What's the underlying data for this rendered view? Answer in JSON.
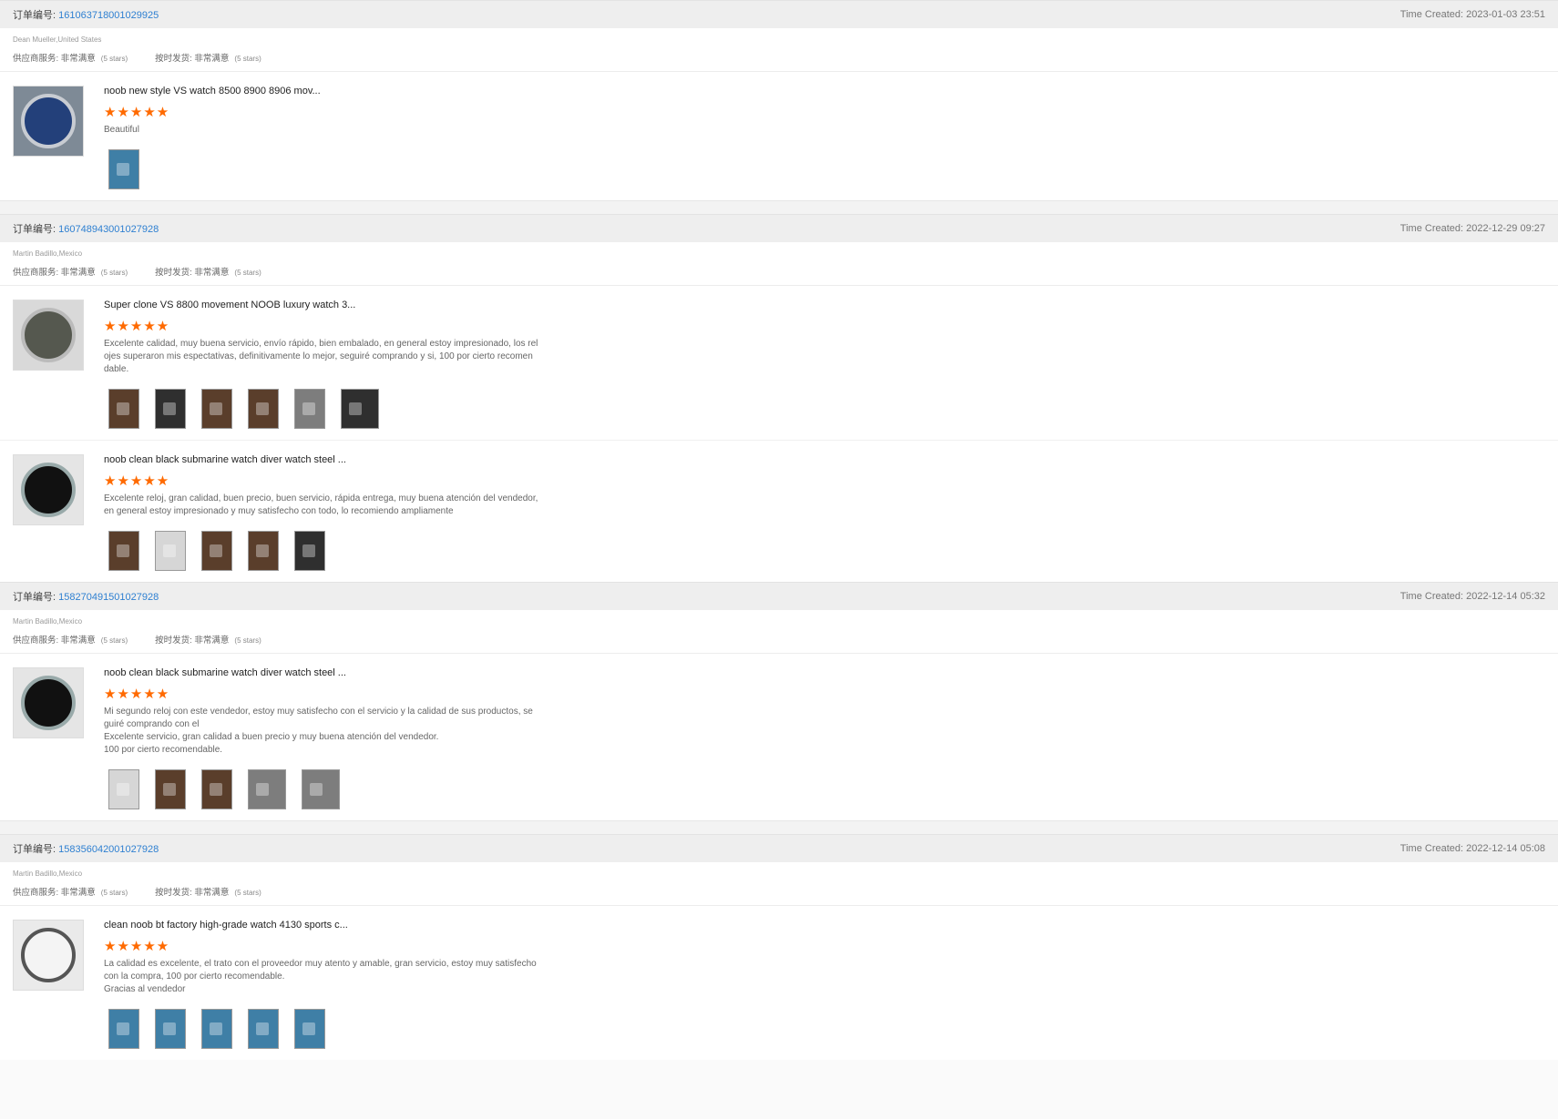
{
  "orders": [
    {
      "order_label": "订单编号:",
      "order_no": "161063718001029925",
      "time_created": "Time Created: 2023-01-03 23:51",
      "buyer": "Dean Mueller,United States",
      "supplier_service": "供应商服务: 非常满意",
      "supplier_stars": "(5 stars)",
      "ship_on_time": "按时发货: 非常满意",
      "ship_stars": "(5 stars)",
      "reviews": [
        {
          "title": "noob new style VS watch 8500 8900 8906 mov...",
          "stars": "★★★★★",
          "comment": "Beautiful"
        }
      ]
    },
    {
      "order_label": "订单编号:",
      "order_no": "160748943001027928",
      "time_created": "Time Created: 2022-12-29 09:27",
      "buyer": "Martin Badillo,Mexico",
      "supplier_service": "供应商服务: 非常满意",
      "supplier_stars": "(5 stars)",
      "ship_on_time": "按时发货: 非常满意",
      "ship_stars": "(5 stars)",
      "reviews": [
        {
          "title": "Super clone VS 8800 movement NOOB luxury watch 3...",
          "stars": "★★★★★",
          "comment": "Excelente calidad, muy buena servicio, envío rápido, bien embalado, en general estoy impresionado, los rel\nojes superaron mis espectativas, definitivamente lo mejor, seguiré comprando y si, 100 por cierto recomen\ndable."
        },
        {
          "title": "noob clean black submarine watch diver watch steel ...",
          "stars": "★★★★★",
          "comment": "Excelente reloj, gran calidad, buen precio, buen servicio, rápida entrega, muy buena atención del vendedor,\nen general estoy impresionado y muy satisfecho con todo, lo recomiendo ampliamente"
        }
      ]
    },
    {
      "order_label": "订单编号:",
      "order_no": "158270491501027928",
      "time_created": "Time Created: 2022-12-14 05:32",
      "buyer": "Martin Badillo,Mexico",
      "supplier_service": "供应商服务: 非常满意",
      "supplier_stars": "(5 stars)",
      "ship_on_time": "按时发货: 非常满意",
      "ship_stars": "(5 stars)",
      "reviews": [
        {
          "title": "noob clean black submarine watch diver watch steel ...",
          "stars": "★★★★★",
          "comment": "Mi segundo reloj con este vendedor, estoy muy satisfecho con el servicio y la calidad de sus productos, se\nguiré comprando con el\nExcelente servicio, gran calidad a buen precio y muy buena atención del vendedor.\n100 por cierto recomendable."
        }
      ]
    },
    {
      "order_label": "订单编号:",
      "order_no": "158356042001027928",
      "time_created": "Time Created: 2022-12-14 05:08",
      "buyer": "Martin Badillo,Mexico",
      "supplier_service": "供应商服务: 非常满意",
      "supplier_stars": "(5 stars)",
      "ship_on_time": "按时发货: 非常满意",
      "ship_stars": "(5 stars)",
      "reviews": [
        {
          "title": "clean noob bt factory high-grade watch 4130 sports c...",
          "stars": "★★★★★",
          "comment": "La calidad es excelente, el trato con el proveedor muy atento y amable, gran servicio, estoy muy satisfecho\ncon la compra, 100 por cierto recomendable.\nGracias al vendedor"
        }
      ]
    }
  ]
}
